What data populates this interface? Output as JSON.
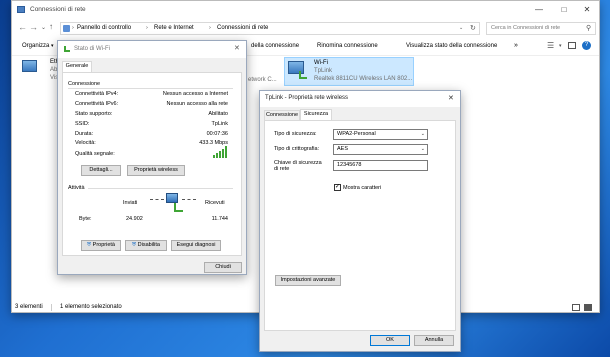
{
  "explorer": {
    "title": "Connessioni di rete",
    "breadcrumb": [
      "Pannello di controllo",
      "Rete e Internet",
      "Connessioni di rete"
    ],
    "search_placeholder": "Cerca in Connessioni di rete",
    "toolbar": {
      "organize": "Organizza",
      "disable": "della connessione",
      "rename": "Rinomina connessione",
      "view_status": "Visualizza stato della connessione",
      "more": "»"
    },
    "ethernet": {
      "name_partial": "Eth",
      "status_partial": "Abi",
      "device_partial": "Vist"
    },
    "network_partial": "etwork C...",
    "wifi": {
      "name": "Wi-Fi",
      "ssid": "TpLink",
      "adapter": "Realtek 8811CU Wireless LAN 802..."
    },
    "status": {
      "count": "3 elementi",
      "selected": "1 elemento selezionato"
    }
  },
  "wifi_status": {
    "title": "Stato di Wi-Fi",
    "tab": "Generale",
    "connection_header": "Connessione",
    "rows": [
      {
        "label": "Connettività IPv4:",
        "value": "Nessun accesso a Internet"
      },
      {
        "label": "Connettività IPv6:",
        "value": "Nessun accesso alla rete"
      },
      {
        "label": "Stato supporto:",
        "value": "Abilitato"
      },
      {
        "label": "SSID:",
        "value": "TpLink"
      },
      {
        "label": "Durata:",
        "value": "00:07:36"
      },
      {
        "label": "Velocità:",
        "value": "433.3 Mbps"
      }
    ],
    "signal_label": "Qualità segnale:",
    "details_button": "Dettagli...",
    "wireless_props_button": "Proprietà wireless",
    "activity_header": "Attività",
    "sent_label": "Inviati",
    "received_label": "Ricevuti",
    "bytes_label": "Byte:",
    "bytes_sent": "24.902",
    "bytes_received": "11.744",
    "properties_button": "Proprietà",
    "disable_button": "Disabilita",
    "diagnose_button": "Esegui diagnosi",
    "close_button": "Chiudi"
  },
  "wireless_props": {
    "title": "TpLink - Proprietà rete wireless",
    "tabs": [
      "Connessione",
      "Sicurezza"
    ],
    "security_type_label": "Tipo di sicurezza:",
    "security_type_value": "WPA2-Personal",
    "encryption_label": "Tipo di crittografia:",
    "encryption_value": "AES",
    "key_label_line1": "Chiave di sicurezza",
    "key_label_line2": "di rete",
    "key_value": "12345678",
    "show_chars_label": "Mostra caratteri",
    "advanced_button": "Impostazioni avanzate",
    "ok_button": "OK",
    "cancel_button": "Annulla"
  },
  "colors": {
    "selection": "#cce8ff",
    "accent": "#0078d7",
    "signal": "#3fa535"
  }
}
